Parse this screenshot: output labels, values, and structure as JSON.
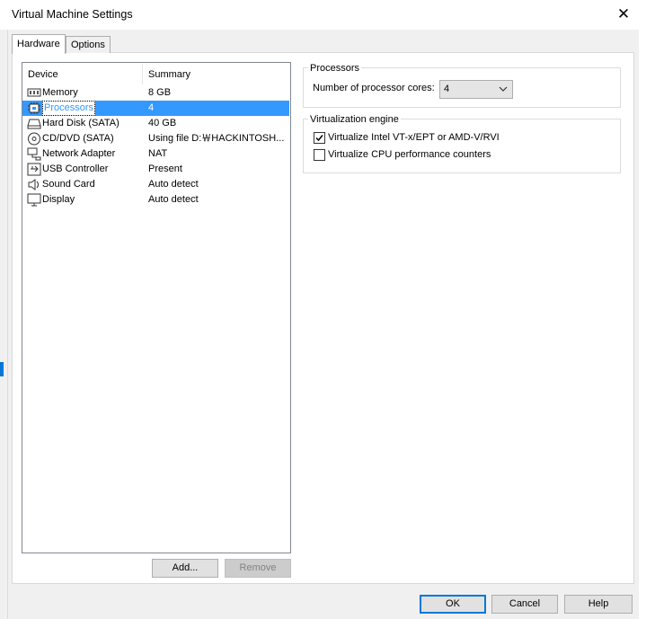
{
  "window": {
    "title": "Virtual Machine Settings",
    "close_glyph": "✕"
  },
  "tabs": [
    {
      "label": "Hardware",
      "active": true
    },
    {
      "label": "Options",
      "active": false
    }
  ],
  "device_list": {
    "columns": [
      "Device",
      "Summary"
    ],
    "rows": [
      {
        "device": "Memory",
        "summary": "8 GB",
        "icon": "memory-icon",
        "selected": false
      },
      {
        "device": "Processors",
        "summary": "4",
        "icon": "processor-icon",
        "selected": true
      },
      {
        "device": "Hard Disk (SATA)",
        "summary": "40 GB",
        "icon": "hard-disk-icon",
        "selected": false
      },
      {
        "device": "CD/DVD (SATA)",
        "summary": "Using file D:￦HACKINTOSH...",
        "icon": "cd-dvd-icon",
        "selected": false
      },
      {
        "device": "Network Adapter",
        "summary": "NAT",
        "icon": "network-adapter-icon",
        "selected": false
      },
      {
        "device": "USB Controller",
        "summary": "Present",
        "icon": "usb-controller-icon",
        "selected": false
      },
      {
        "device": "Sound Card",
        "summary": "Auto detect",
        "icon": "sound-card-icon",
        "selected": false
      },
      {
        "device": "Display",
        "summary": "Auto detect",
        "icon": "display-icon",
        "selected": false
      }
    ],
    "add_label": "Add...",
    "remove_label": "Remove"
  },
  "processors": {
    "group_label": "Processors",
    "cores_label": "Number of processor cores:",
    "cores_value": "4"
  },
  "virtualization": {
    "group_label": "Virtualization engine",
    "options": [
      {
        "label": "Virtualize Intel VT-x/EPT or AMD-V/RVI",
        "checked": true
      },
      {
        "label": "Virtualize CPU performance counters",
        "checked": false
      }
    ]
  },
  "footer": {
    "ok_label": "OK",
    "cancel_label": "Cancel",
    "help_label": "Help"
  },
  "colors": {
    "selection": "#3399ff",
    "accent": "#0078d7"
  }
}
